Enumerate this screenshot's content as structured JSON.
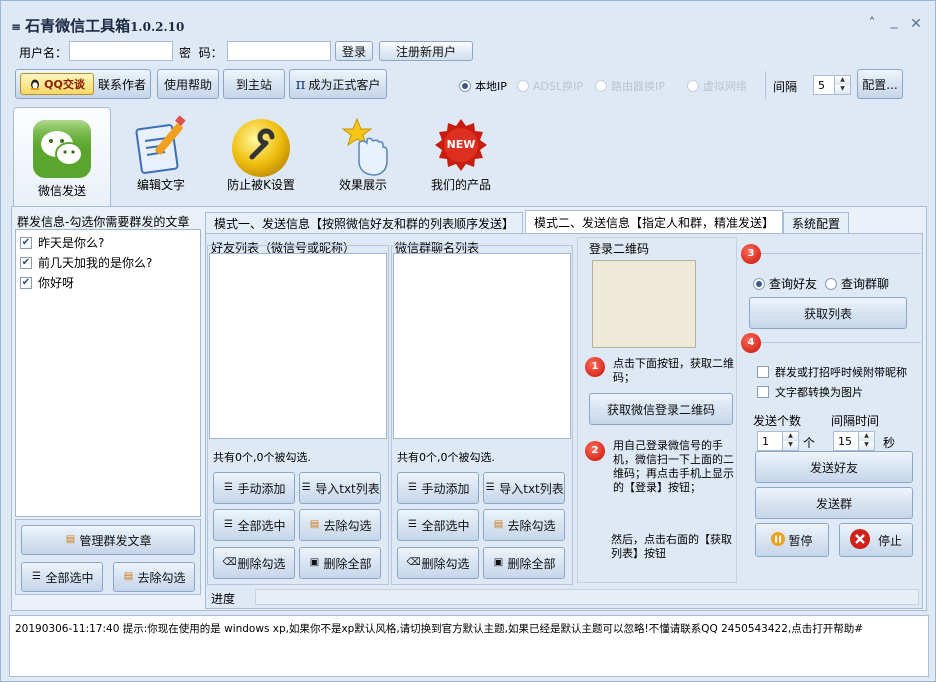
{
  "app": {
    "title": "石青微信工具箱",
    "version": "1.0.2.10",
    "menu_glyph": "≡"
  },
  "window_controls": {
    "up": "˄",
    "min": "_",
    "close": "✕"
  },
  "login": {
    "username_label": "用户名：",
    "username_value": "",
    "password_label": "密  码：",
    "password_value": "",
    "login_button": "登录",
    "register_button": "注册新用户"
  },
  "toolbar": {
    "qq_button": "QQ交谈",
    "contact_label": "联系作者",
    "help_button": "使用帮助",
    "homepage_button": "到主站",
    "vip_button": "成为正式客户",
    "vip_icon": "π",
    "ip_options": [
      {
        "label": "本地IP",
        "selected": true,
        "disabled": false
      },
      {
        "label": "ADSL换IP",
        "selected": false,
        "disabled": true
      },
      {
        "label": "路由器换IP",
        "selected": false,
        "disabled": true
      },
      {
        "label": "虚拟网络",
        "selected": false,
        "disabled": true
      }
    ],
    "interval_label": "间隔",
    "interval_value": "5",
    "config_button": "配置..."
  },
  "nav": [
    {
      "label": "微信发送",
      "icon": "wechat-icon",
      "selected": true
    },
    {
      "label": "编辑文字",
      "icon": "edit-document-icon",
      "selected": false
    },
    {
      "label": "防止被K设置",
      "icon": "wrench-icon",
      "selected": false
    },
    {
      "label": "效果展示",
      "icon": "hand-star-icon",
      "selected": false
    },
    {
      "label": "我们的产品",
      "icon": "new-badge-icon",
      "selected": false
    },
    {
      "new_text": "NEW"
    }
  ],
  "left_panel": {
    "title": "群发信息-勾选你需要群发的文章",
    "items": [
      {
        "label": "昨天是你么?",
        "checked": true
      },
      {
        "label": "前几天加我的是你么?",
        "checked": true
      },
      {
        "label": "你好呀",
        "checked": true
      }
    ],
    "manage_button": "管理群发文章",
    "select_all_button": "全部选中",
    "deselect_button": "去除勾选"
  },
  "tabs": [
    {
      "label": "模式一、发送信息【按照微信好友和群的列表顺序发送】",
      "active": false
    },
    {
      "label": "模式二、发送信息【指定人和群，精准发送】",
      "active": true
    },
    {
      "label": "系统配置",
      "active": false
    }
  ],
  "friends": {
    "title": "好友列表（微信号或昵称）",
    "status": "共有0个,0个被勾选.",
    "add_button": "手动添加",
    "import_button": "导入txt列表",
    "select_all_button": "全部选中",
    "deselect_button": "去除勾选",
    "delete_checked_button": "删除勾选",
    "delete_all_button": "删除全部"
  },
  "groups": {
    "title": "微信群聊名列表",
    "status": "共有0个,0个被勾选.",
    "add_button": "手动添加",
    "import_button": "导入txt列表",
    "select_all_button": "全部选中",
    "deselect_button": "去除勾选",
    "delete_checked_button": "删除勾选",
    "delete_all_button": "删除全部"
  },
  "qr": {
    "title": "登录二维码",
    "step1_badge": "1",
    "step1_text": "点击下面按钮，获取二维码；",
    "get_qr_button": "获取微信登录二维码",
    "step2_badge": "2",
    "step2_text": "用自己登录微信号的手机，微信扫一下上面的二维码；再点击手机上显示的【登录】按钮；",
    "step2_text2": "然后，点击右面的【获取列表】按钮"
  },
  "right_panel": {
    "step3_badge": "3",
    "query_friends": "查询好友",
    "query_groups": "查询群聊",
    "get_list_button": "获取列表",
    "step4_badge": "4",
    "opt_nickname": "群发或打招呼时候附带昵称",
    "opt_image": "文字都转换为图片",
    "send_count_label": "发送个数",
    "send_count_value": "1",
    "send_count_unit": "个",
    "interval_label": "间隔时间",
    "interval_value": "15",
    "interval_unit": "秒",
    "send_friends_button": "发送好友",
    "send_groups_button": "发送群",
    "pause_button": "暂停",
    "stop_button": "停止"
  },
  "progress": {
    "label": "进度",
    "value": 0
  },
  "status_bar": {
    "text": "20190306-11:17:40  提示:你现在使用的是 windows xp,如果你不是xp默认风格,请切换到官方默认主题,如果已经是默认主题可以忽略!不懂请联系QQ 2450543422,点击打开帮助#"
  },
  "colors": {
    "accent": "#3b5a8a",
    "badge_red": "#c5120a",
    "window_bg": "#dfe9f5"
  }
}
